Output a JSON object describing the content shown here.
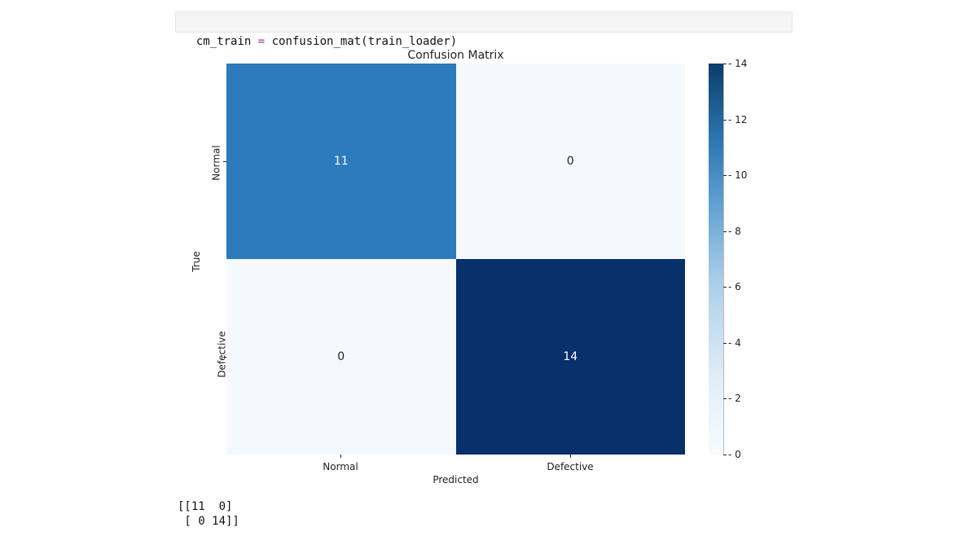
{
  "code": {
    "varname": "cm_train",
    "assign": " = ",
    "call": "confusion_mat",
    "lparen": "(",
    "arg": "train_loader",
    "rparen": ")"
  },
  "chart_data": {
    "type": "heatmap",
    "title": "Confusion Matrix",
    "xlabel": "Predicted",
    "ylabel": "True",
    "categories_x": [
      "Normal",
      "Defective"
    ],
    "categories_y": [
      "Normal",
      "Defective"
    ],
    "values": [
      [
        11,
        0
      ],
      [
        0,
        14
      ]
    ],
    "colorbar": {
      "min": 0,
      "max": 14,
      "ticks": [
        0,
        2,
        4,
        6,
        8,
        10,
        12,
        14
      ]
    },
    "cell_colors": [
      [
        "#2d7bbd",
        "#f4f9fd"
      ],
      [
        "#f4f9fd",
        "#08306b"
      ]
    ],
    "cell_text_color": [
      [
        "light",
        "dark"
      ],
      [
        "dark",
        "light"
      ]
    ]
  },
  "output_text": "[[11  0]\n [ 0 14]]"
}
